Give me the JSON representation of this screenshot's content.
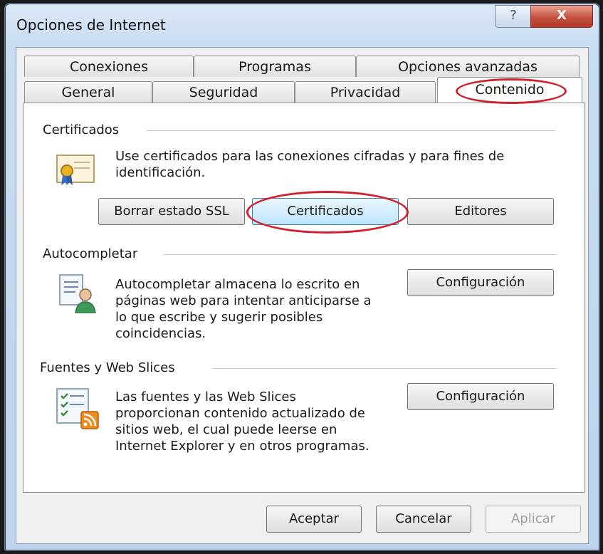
{
  "window": {
    "title": "Opciones de Internet",
    "help_glyph": "?",
    "close_glyph": "X"
  },
  "tabs": {
    "row1": [
      {
        "label": "Conexiones"
      },
      {
        "label": "Programas"
      },
      {
        "label": "Opciones avanzadas"
      }
    ],
    "row2": [
      {
        "label": "General"
      },
      {
        "label": "Seguridad"
      },
      {
        "label": "Privacidad"
      },
      {
        "label": "Contenido"
      }
    ],
    "active": "Contenido"
  },
  "certificados": {
    "title": "Certificados",
    "description_line1": "Use certificados para las conexiones cifradas y para fines de",
    "description_line2": "identificación.",
    "btn_clear_ssl": "Borrar estado SSL",
    "btn_certificates": "Certificados",
    "btn_editors": "Editores",
    "icon": "certificate-icon"
  },
  "autocompletar": {
    "title": "Autocompletar",
    "lines": [
      "Autocompletar almacena lo escrito en",
      "páginas web para intentar anticiparse a",
      "lo que escribe y sugerir posibles",
      "coincidencias."
    ],
    "btn_config": "Configuración",
    "icon": "autocomplete-user-icon"
  },
  "fuentes": {
    "title": "Fuentes y Web Slices",
    "lines": [
      "Las fuentes y las Web Slices",
      "proporcionan contenido actualizado de",
      "sitios web, el cual puede leerse en",
      "Internet Explorer y en otros programas."
    ],
    "btn_config": "Configuración",
    "icon": "rss-feed-icon"
  },
  "footer": {
    "ok": "Aceptar",
    "cancel": "Cancelar",
    "apply": "Aplicar"
  },
  "colors": {
    "annotation_ring": "#d2202e",
    "focus_border": "#3c7fb1"
  }
}
